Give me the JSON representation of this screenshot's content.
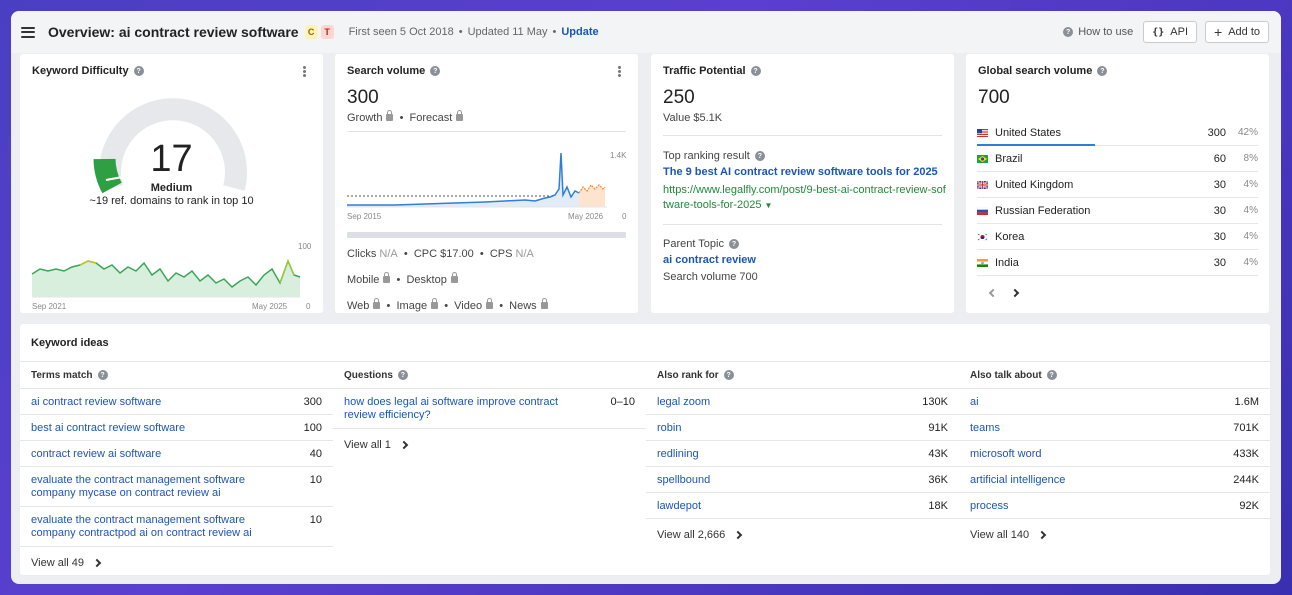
{
  "header": {
    "title": "Overview: ai contract review software",
    "badge_c": "C",
    "badge_t": "T",
    "first_seen": "First seen 5 Oct 2018",
    "updated": "Updated 11 May",
    "update_label": "Update",
    "how_to_use": "How to use",
    "api_label": "API",
    "add_to_label": "Add to"
  },
  "kd": {
    "title": "Keyword Difficulty",
    "value": "17",
    "level": "Medium",
    "note": "~19 ref. domains to rank in top 10",
    "chart_start": "Sep 2021",
    "chart_end": "May 2025",
    "chart_max": "100",
    "chart_min": "0"
  },
  "sv": {
    "title": "Search volume",
    "value": "300",
    "growth": "Growth",
    "forecast": "Forecast",
    "chart_start": "Sep 2015",
    "chart_end": "May 2026",
    "chart_max": "1.4K",
    "chart_min": "0",
    "clicks_label": "Clicks",
    "clicks_value": "N/A",
    "cpc": "CPC $17.00",
    "cps_label": "CPS",
    "cps_value": "N/A",
    "mobile": "Mobile",
    "desktop": "Desktop",
    "web": "Web",
    "image": "Image",
    "video": "Video",
    "news": "News"
  },
  "tp": {
    "title": "Traffic Potential",
    "value": "250",
    "value_usd": "Value $5.1K",
    "top_result_label": "Top ranking result",
    "top_result_title": "The 9 best AI contract review software tools for 2025",
    "top_result_url_1": "https://www.legalfly.com/post/9-best-ai-contract-review-sof",
    "top_result_url_2": "tware-tools-for-2025",
    "parent_label": "Parent Topic",
    "parent_value": "ai contract review",
    "parent_sv": "Search volume 700"
  },
  "gsv": {
    "title": "Global search volume",
    "value": "700",
    "countries": [
      {
        "name": "United States",
        "value": "300",
        "pct": "42%"
      },
      {
        "name": "Brazil",
        "value": "60",
        "pct": "8%"
      },
      {
        "name": "United Kingdom",
        "value": "30",
        "pct": "4%"
      },
      {
        "name": "Russian Federation",
        "value": "30",
        "pct": "4%"
      },
      {
        "name": "Korea",
        "value": "30",
        "pct": "4%"
      },
      {
        "name": "India",
        "value": "30",
        "pct": "4%"
      }
    ]
  },
  "ideas": {
    "title": "Keyword ideas",
    "terms": {
      "head": "Terms match",
      "rows": [
        {
          "k": "ai contract review software",
          "v": "300"
        },
        {
          "k": "best ai contract review software",
          "v": "100"
        },
        {
          "k": "contract review ai software",
          "v": "40"
        },
        {
          "k": "evaluate the contract management software company mycase on contract review ai",
          "v": "10"
        },
        {
          "k": "evaluate the contract management software company contractpod ai on contract review ai",
          "v": "10"
        }
      ],
      "view_all": "View all 49"
    },
    "questions": {
      "head": "Questions",
      "rows": [
        {
          "k": "how does legal ai software improve contract review efficiency?",
          "v": "0–10"
        }
      ],
      "view_all": "View all 1"
    },
    "also_rank": {
      "head": "Also rank for",
      "rows": [
        {
          "k": "legal zoom",
          "v": "130K"
        },
        {
          "k": "robin",
          "v": "91K"
        },
        {
          "k": "redlining",
          "v": "43K"
        },
        {
          "k": "spellbound",
          "v": "36K"
        },
        {
          "k": "lawdepot",
          "v": "18K"
        }
      ],
      "view_all": "View all 2,666"
    },
    "also_talk": {
      "head": "Also talk about",
      "rows": [
        {
          "k": "ai",
          "v": "1.6M"
        },
        {
          "k": "teams",
          "v": "701K"
        },
        {
          "k": "microsoft word",
          "v": "433K"
        },
        {
          "k": "artificial intelligence",
          "v": "244K"
        },
        {
          "k": "process",
          "v": "92K"
        }
      ],
      "view_all": "View all 140"
    }
  }
}
